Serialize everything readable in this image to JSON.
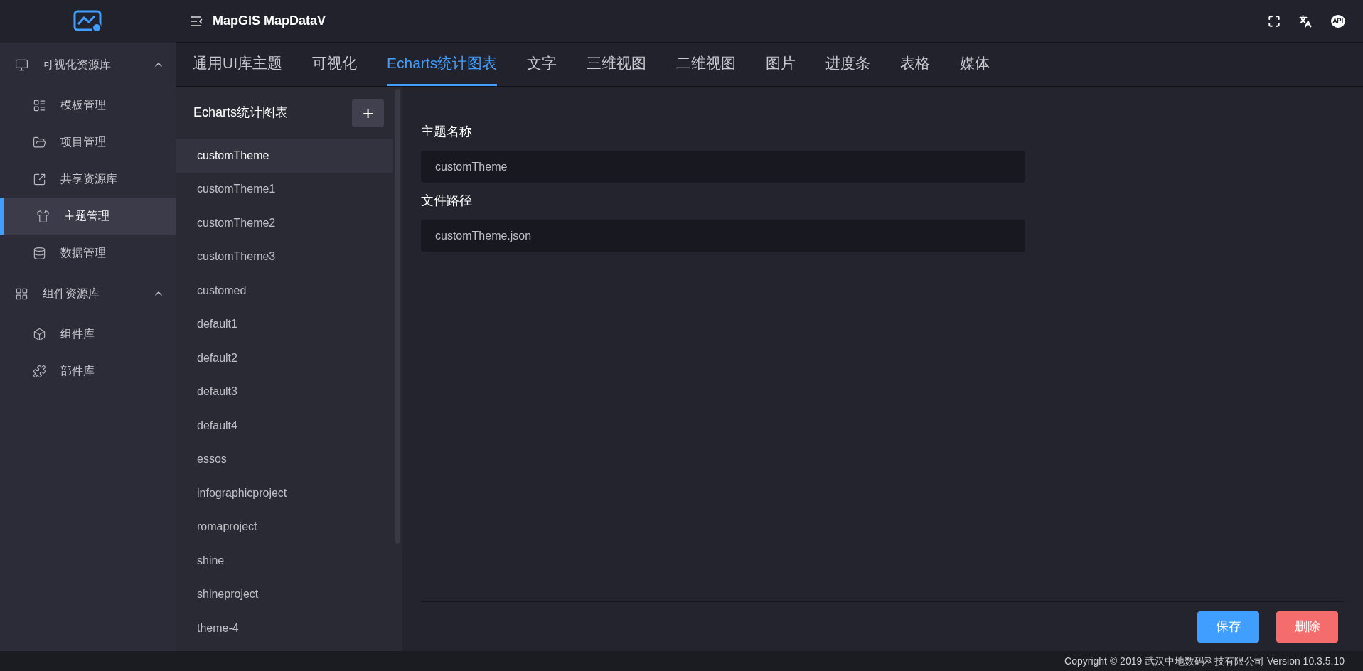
{
  "header": {
    "title": "MapGIS MapDataV"
  },
  "sidebar": {
    "groups": [
      {
        "label": "可视化资源库",
        "kind": "monitor",
        "expanded": true,
        "items": [
          {
            "label": "模板管理",
            "kind": "template",
            "selected": false
          },
          {
            "label": "项目管理",
            "kind": "folder",
            "selected": false
          },
          {
            "label": "共享资源库",
            "kind": "share",
            "selected": false
          },
          {
            "label": "主题管理",
            "kind": "shirt",
            "selected": true
          },
          {
            "label": "数据管理",
            "kind": "database",
            "selected": false
          }
        ]
      },
      {
        "label": "组件资源库",
        "kind": "grid",
        "expanded": true,
        "items": [
          {
            "label": "组件库",
            "kind": "box",
            "selected": false
          },
          {
            "label": "部件库",
            "kind": "puzzle",
            "selected": false
          }
        ]
      }
    ]
  },
  "tabs": [
    {
      "label": "通用UI库主题",
      "selected": false
    },
    {
      "label": "可视化",
      "selected": false
    },
    {
      "label": "Echarts统计图表",
      "selected": true
    },
    {
      "label": "文字",
      "selected": false
    },
    {
      "label": "三维视图",
      "selected": false
    },
    {
      "label": "二维视图",
      "selected": false
    },
    {
      "label": "图片",
      "selected": false
    },
    {
      "label": "进度条",
      "selected": false
    },
    {
      "label": "表格",
      "selected": false
    },
    {
      "label": "媒体",
      "selected": false
    }
  ],
  "theme_list": {
    "title": "Echarts统计图表",
    "add_button": "+",
    "items": [
      {
        "label": "customTheme",
        "selected": true
      },
      {
        "label": "customTheme1",
        "selected": false
      },
      {
        "label": "customTheme2",
        "selected": false
      },
      {
        "label": "customTheme3",
        "selected": false
      },
      {
        "label": "customed",
        "selected": false
      },
      {
        "label": "default1",
        "selected": false
      },
      {
        "label": "default2",
        "selected": false
      },
      {
        "label": "default3",
        "selected": false
      },
      {
        "label": "default4",
        "selected": false
      },
      {
        "label": "essos",
        "selected": false
      },
      {
        "label": "infographicproject",
        "selected": false
      },
      {
        "label": "romaproject",
        "selected": false
      },
      {
        "label": "shine",
        "selected": false
      },
      {
        "label": "shineproject",
        "selected": false
      },
      {
        "label": "theme-4",
        "selected": false
      }
    ]
  },
  "form": {
    "fields": [
      {
        "label": "主题名称",
        "value": "customTheme"
      },
      {
        "label": "文件路径",
        "value": "customTheme.json"
      }
    ],
    "buttons": [
      {
        "label": "保存",
        "kind": "primary"
      },
      {
        "label": "删除",
        "kind": "danger"
      }
    ]
  },
  "footer": {
    "text": "Copyright © 2019 武汉中地数码科技有限公司 Version 10.3.5.10"
  }
}
